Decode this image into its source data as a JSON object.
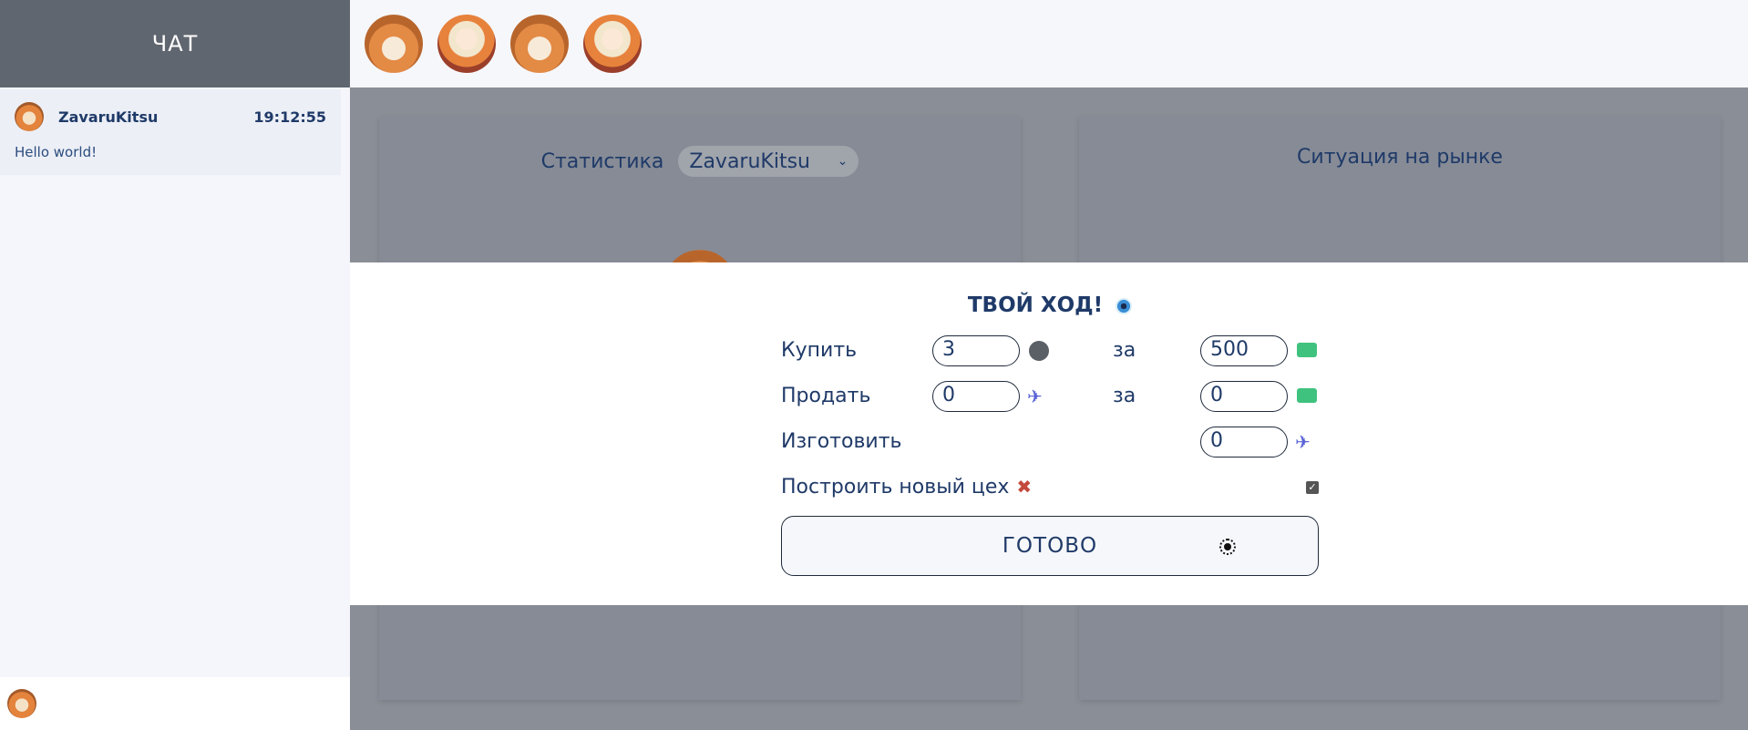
{
  "sidebar": {
    "header": "ЧАТ",
    "messages": [
      {
        "user": "ZavaruKitsu",
        "time": "19:12:55",
        "text": "Hello world!",
        "avatar": "fox-avatar"
      }
    ],
    "footer_avatar": "fox-avatar"
  },
  "topbar": {
    "players": [
      {
        "avatar": "fox-avatar"
      },
      {
        "avatar": "girl-avatar"
      },
      {
        "avatar": "fox-avatar"
      },
      {
        "avatar": "girl-avatar"
      }
    ]
  },
  "stats": {
    "label": "Статистика",
    "selected_player": "ZavaruKitsu"
  },
  "market": {
    "title": "Ситуация на рынке"
  },
  "turn": {
    "title": "ТВОЙ ХОД!",
    "title_icon": "eye-icon",
    "buy": {
      "label": "Купить",
      "quantity": "3",
      "quantity_icon": "raw-material-icon",
      "for_label": "за",
      "price": "500",
      "price_icon": "money-icon"
    },
    "sell": {
      "label": "Продать",
      "quantity": "0",
      "quantity_icon": "plane-icon",
      "for_label": "за",
      "price": "0",
      "price_icon": "money-icon"
    },
    "produce": {
      "label": "Изготовить",
      "quantity": "0",
      "quantity_icon": "plane-icon"
    },
    "build": {
      "label": "Построить новый цех",
      "icon": "tools-icon",
      "checked": true
    },
    "done_button": "ГОТОВО"
  },
  "colors": {
    "header_bg": "#606670",
    "text": "#1f3a68",
    "overlay": "#8a8e96",
    "money": "#3fc27e",
    "plane": "#5a64d6"
  }
}
